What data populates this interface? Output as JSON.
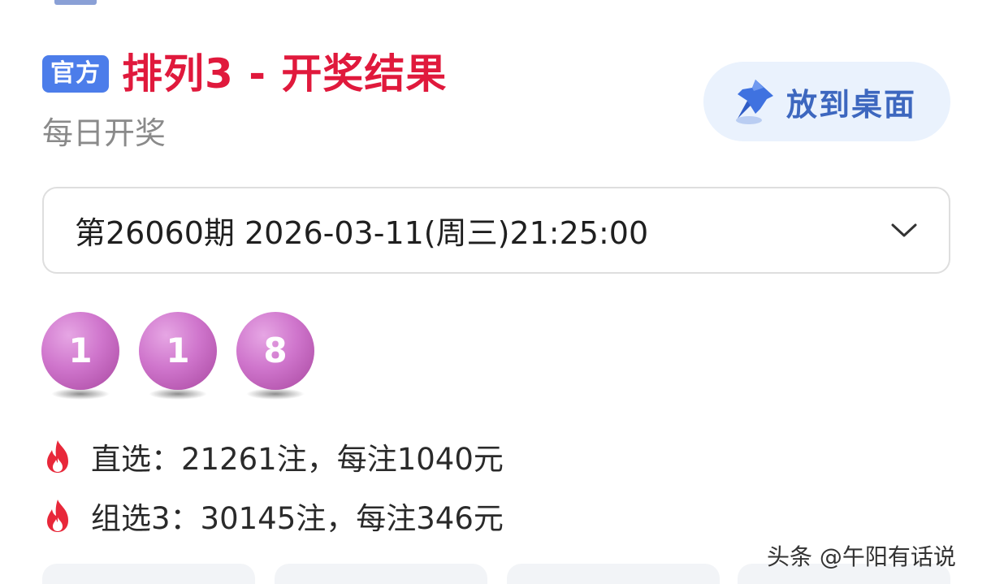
{
  "header": {
    "badge": "官方",
    "title": "排列3 - 开奖结果",
    "subtitle": "每日开奖"
  },
  "pin_button": {
    "label": "放到桌面",
    "icon": "pushpin-icon"
  },
  "period_select": {
    "value": "第26060期 2026-03-11(周三)21:25:00",
    "icon": "chevron-down-icon"
  },
  "balls": [
    "1",
    "1",
    "8"
  ],
  "prizes": [
    {
      "icon": "fire-icon",
      "text": "直选：21261注，每注1040元"
    },
    {
      "icon": "fire-icon",
      "text": "组选3：30145注，每注346元"
    }
  ],
  "watermark": "头条 @午阳有话说",
  "colors": {
    "badge_bg": "#4c7dea",
    "title_red": "#e0193c",
    "pin_button_bg": "#eaf2fd",
    "pin_label": "#3d67bf",
    "ball": "#cf75cc",
    "fire": "#e8283a"
  }
}
